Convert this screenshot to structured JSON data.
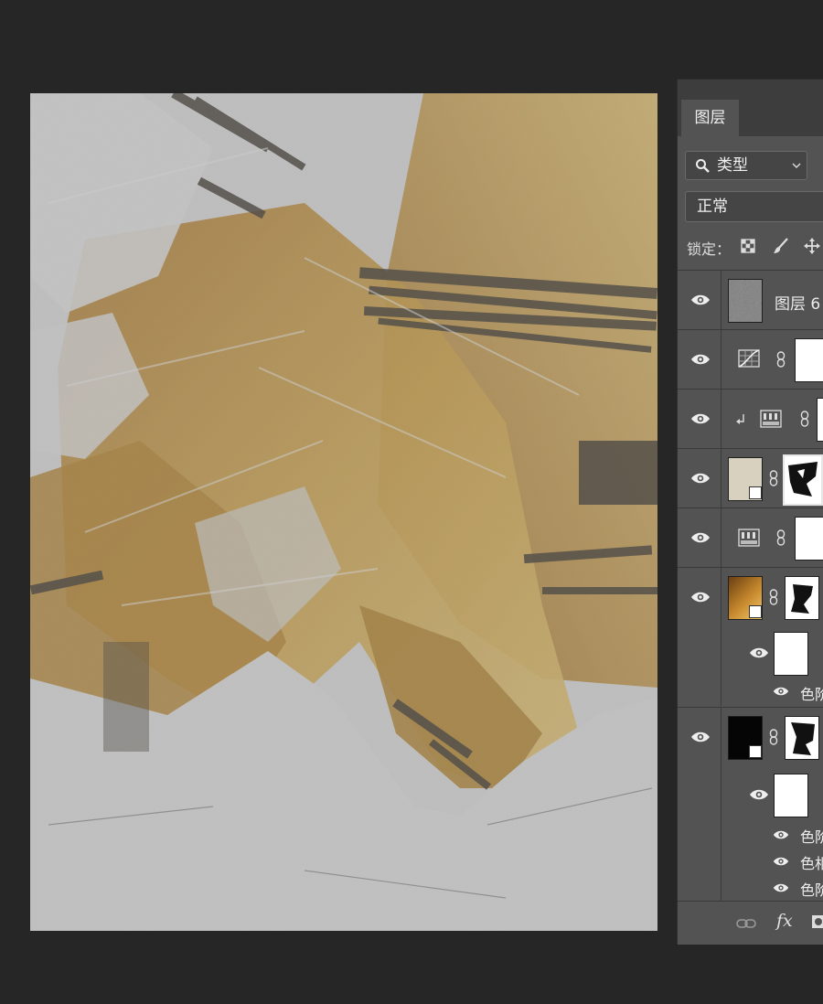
{
  "panel": {
    "tab_label": "图层",
    "filter_label": "类型",
    "blend_mode": "正常",
    "lock_label": "锁定：",
    "layers": [
      {
        "name": "图层 6",
        "kind": "noise-layer"
      },
      {
        "name": "",
        "kind": "curves-adjustment"
      },
      {
        "name": "",
        "kind": "gradient-map-adjustment",
        "clipped": true
      },
      {
        "name": "",
        "kind": "smart-object-paper"
      },
      {
        "name": "",
        "kind": "gradient-map-adjustment"
      },
      {
        "name": "",
        "kind": "smart-object-gold"
      },
      {
        "name": "",
        "kind": "smart-filter-mask"
      },
      {
        "name": "色阶",
        "kind": "smart-filter"
      },
      {
        "name": "",
        "kind": "smart-object-black"
      },
      {
        "name": "",
        "kind": "smart-filter-mask"
      },
      {
        "name": "色阶",
        "kind": "smart-filter"
      },
      {
        "name": "色相",
        "kind": "smart-filter"
      },
      {
        "name": "色阶",
        "kind": "smart-filter"
      }
    ],
    "footer_icons": [
      "link-icon",
      "fx-icon",
      "mask-icon"
    ]
  },
  "colors": {
    "app_bg": "#262626",
    "panel_bg": "#535353",
    "gold": "#c6983a",
    "paper": "#dedede",
    "ink": "#3a352b"
  }
}
